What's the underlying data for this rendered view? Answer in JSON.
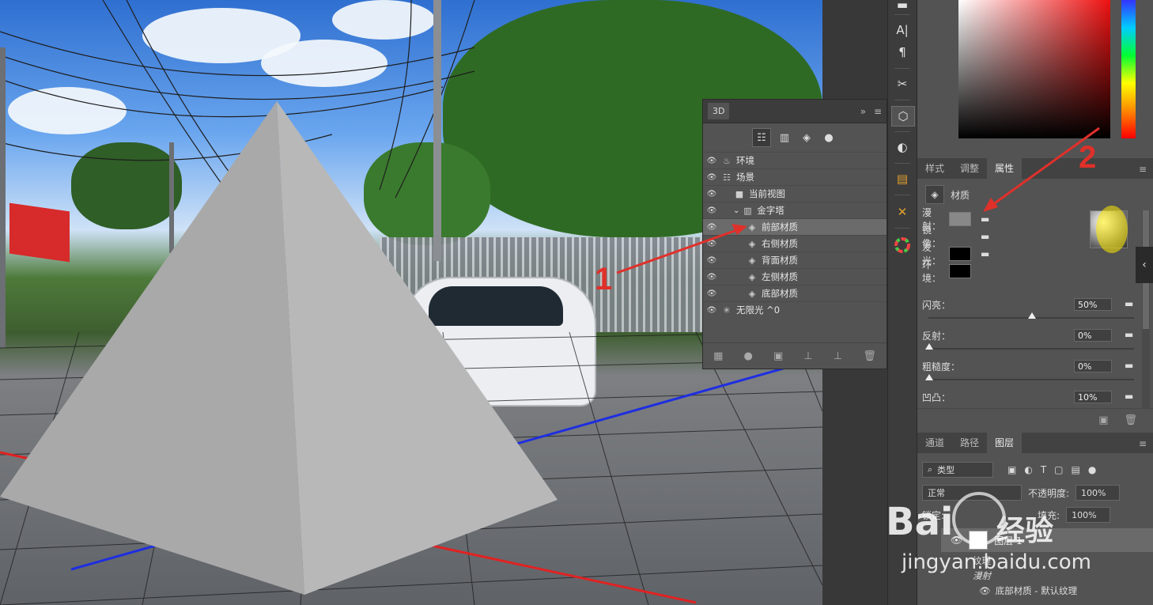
{
  "panel3d": {
    "tab": "3D",
    "collapse_icon": "double-chevron-icon",
    "menu_icon": "menu-icon",
    "filters": [
      "scene-filter-icon",
      "mesh-filter-icon",
      "material-filter-icon",
      "light-filter-icon"
    ],
    "tree": [
      {
        "label": "环境",
        "icon": "environment-icon",
        "indent": 0,
        "selected": false
      },
      {
        "label": "场景",
        "icon": "scene-icon",
        "indent": 0,
        "selected": false
      },
      {
        "label": "当前视图",
        "icon": "camera-icon",
        "indent": 1,
        "selected": false
      },
      {
        "label": "金字塔",
        "icon": "mesh-icon",
        "indent": 1,
        "selected": false
      },
      {
        "label": "前部材质",
        "icon": "material-icon",
        "indent": 2,
        "selected": true
      },
      {
        "label": "右侧材质",
        "icon": "material-icon",
        "indent": 2,
        "selected": false
      },
      {
        "label": "背面材质",
        "icon": "material-icon",
        "indent": 2,
        "selected": false
      },
      {
        "label": "左侧材质",
        "icon": "material-icon",
        "indent": 2,
        "selected": false
      },
      {
        "label": "底部材质",
        "icon": "material-icon",
        "indent": 2,
        "selected": false
      },
      {
        "label": "无限光 ^0",
        "icon": "infinite-light-icon",
        "indent": 0,
        "selected": false
      }
    ]
  },
  "tools": [
    "text-tool-icon",
    "paragraph-icon",
    "tools-icon",
    "3d-cube-icon",
    "3d-material-icon",
    "pins-icon",
    "crossed-tools-icon",
    "color-wheel-icon"
  ],
  "props_tabs": {
    "tabs": [
      "样式",
      "调整",
      "属性"
    ],
    "active": "属性"
  },
  "props": {
    "header": "材质",
    "rows": [
      {
        "label": "漫射：",
        "swatch": "gray"
      },
      {
        "label": "镜像：",
        "swatch": "none"
      },
      {
        "label": "发光：",
        "swatch": "black"
      },
      {
        "label": "环境：",
        "swatch": "black"
      }
    ],
    "sliders": [
      {
        "label": "闪亮：",
        "value": "50%",
        "level": 0.5
      },
      {
        "label": "反射：",
        "value": "0%",
        "level": 0
      },
      {
        "label": "粗糙度：",
        "value": "0%",
        "level": 0
      },
      {
        "label": "凹凸：",
        "value": "10%",
        "level": 0.1
      }
    ]
  },
  "layers_tabs": {
    "tabs": [
      "通道",
      "路径",
      "图层"
    ],
    "active": "图层"
  },
  "layers": {
    "filter_label": "类型",
    "blend_mode": "正常",
    "opacity_label": "不透明度:",
    "opacity_value": "100%",
    "lock_label": "锁定:",
    "fill_label": "填充:",
    "fill_value": "100%",
    "layer_name": "图层 1",
    "sub1": "纹理",
    "sub2": "漫射",
    "sub3": "底部材质 - 默认纹理"
  },
  "annotations": {
    "label1": "1",
    "label2": "2"
  },
  "watermark": {
    "brand": "Bai",
    "brand2": "经验",
    "url": "jingyan.baidu.com"
  },
  "colors": {
    "accent": "#e0302a",
    "panel_bg": "#535353",
    "toolbar_bg": "#3c3c3c"
  }
}
